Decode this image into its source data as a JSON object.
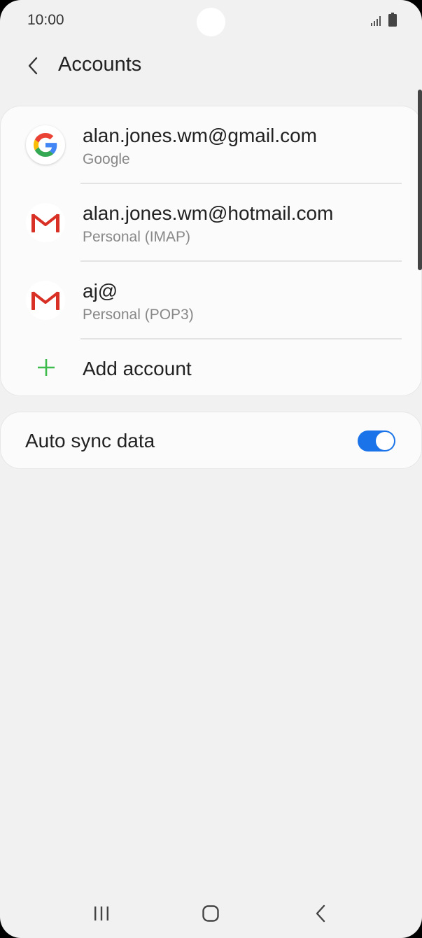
{
  "status_bar": {
    "time": "10:00"
  },
  "header": {
    "title": "Accounts"
  },
  "accounts": [
    {
      "email": "alan.jones.wm@gmail.com",
      "type": "Google",
      "icon": "google-icon"
    },
    {
      "email": "alan.jones.wm@hotmail.com",
      "type": "Personal (IMAP)",
      "icon": "gmail-icon"
    },
    {
      "email": "aj@",
      "type": "Personal (POP3)",
      "icon": "gmail-icon"
    }
  ],
  "add_account": {
    "label": "Add account",
    "icon": "plus-icon",
    "color": "#3dbb4d"
  },
  "auto_sync": {
    "label": "Auto sync data",
    "enabled": true,
    "toggle_color": "#1a73e8"
  }
}
